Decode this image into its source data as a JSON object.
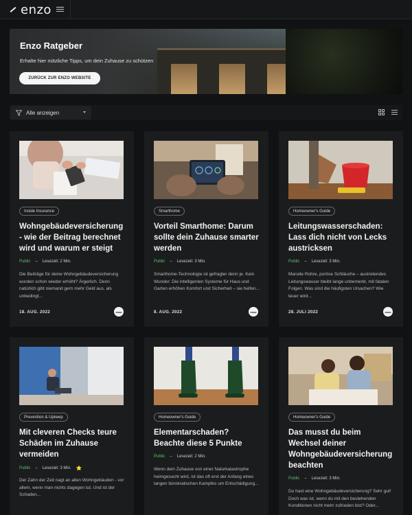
{
  "header": {
    "logo_text": "enzo",
    "menu_icon": "hamburger-icon"
  },
  "hero": {
    "title": "Enzo Ratgeber",
    "subtitle": "Erhalte hier nützliche Tipps, um dein Zuhause zu schützen",
    "button_label": "ZURÜCK ZUR ENZO WEBSITE"
  },
  "filter": {
    "selected": "Alle anzeigen",
    "icon": "funnel-icon"
  },
  "view": {
    "grid_icon": "grid-view-icon",
    "list_icon": "list-view-icon"
  },
  "colors": {
    "background": "#111213",
    "card": "#1b1c1d",
    "public": "#5fbf73",
    "star": "#e8c33a"
  },
  "cards": [
    {
      "tag": "Inside Insurance",
      "title": "Wohngebäudeversicherung - wie der Beitrag berechnet wird und warum er steigt",
      "status": "Public",
      "sep": "–",
      "reading_time": "Lesezeit: 2 Min.",
      "excerpt": "Die Beiträge für deine Wohngebäudeversicherung wurden schon wieder erhöht? Ärgerlich. Denn natürlich gibt niemand gern mehr Geld aus, als unbedingt...",
      "date": "18. AUG. 2022",
      "avatar": "enzo"
    },
    {
      "tag": "Smarthome",
      "title": "Vorteil Smarthome: Darum sollte dein Zuhause smarter werden",
      "status": "Public",
      "sep": "–",
      "reading_time": "Lesezeit: 3 Min.",
      "excerpt": "Smarthome-Technologie ist gefragter denn je. Kein Wunder: Die intelligenten Systeme für Haus und Garten erhöhen Komfort und Sicherheit – sie helfen...",
      "date": "8. AUG. 2022",
      "avatar": "enzo"
    },
    {
      "tag": "Homeowner's Guide",
      "title": "Leitungswasserschaden: Lass dich nicht von Lecks austricksen",
      "status": "Public",
      "sep": "–",
      "reading_time": "Lesezeit: 3 Min.",
      "excerpt": "Marode Rohre, poröse Schläuche – austretendes Leitungswasser bleibt lange unbemerkt, mit fatalen Folgen. Was sind die häufigsten Ursachen? Wie teuer wird...",
      "date": "28. JULI 2022",
      "avatar": "enzo"
    },
    {
      "tag": "Prevention & Upkeep",
      "title": "Mit cleveren Checks teure Schäden im Zuhause vermeiden",
      "status": "Public",
      "sep": "–",
      "reading_time": "Lesezeit: 3 Min.",
      "featured": "⭐",
      "excerpt": "Der Zahn der Zeit nagt an allen Wohngebäuden - vor allem, wenn man nichts dagegen tut. Und ist der Schaden..."
    },
    {
      "tag": "Homeowner's Guide",
      "title": "Elementarschaden? Beachte diese 5 Punkte",
      "status": "Public",
      "sep": "–",
      "reading_time": "Lesezeit: 2 Min.",
      "excerpt": "Wenn dein Zuhause von einer Naturkatastrophe heimgesucht wird, ist das oft erst der Anfang eines langen bürokratischen Kampfes um Entschädigung..."
    },
    {
      "tag": "Homeowner's Guide",
      "title": "Das musst du beim Wechsel deiner Wohngebäudeversicherung beachten",
      "status": "Public",
      "sep": "–",
      "reading_time": "Lesezeit: 3 Min.",
      "excerpt": "Du hast eine Wohngebäudeversicherung? Sehr gut! Doch was ist, wenn du mit den bestehenden Konditionen nicht mehr zufrieden bist? Oder..."
    }
  ]
}
